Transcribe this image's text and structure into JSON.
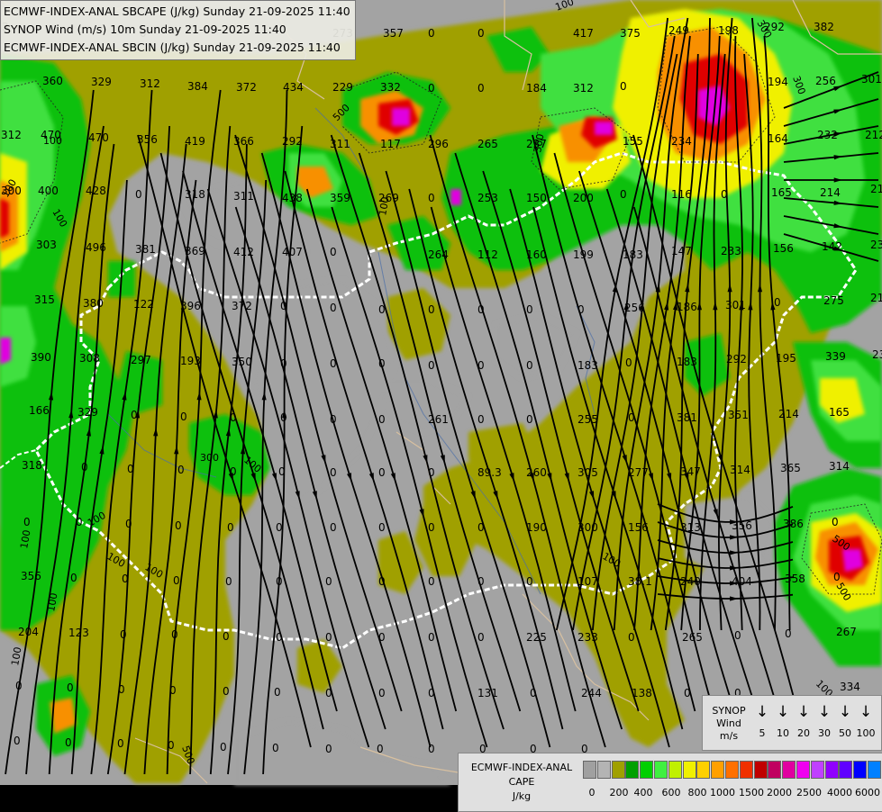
{
  "titles": {
    "line1": "ECMWF-INDEX-ANAL SBCAPE (J/kg) Sunday 21-09-2025 11:40",
    "line2": "SYNOP Wind (m/s) 10m Sunday 21-09-2025 11:40",
    "line3": "ECMWF-INDEX-ANAL SBCIN (J/kg) Sunday 21-09-2025 11:40"
  },
  "colors": {
    "background": "#a3a3a3",
    "olive": "#a0a000",
    "green": "#10c010",
    "lightgreen": "#40e040",
    "yellow": "#f0f000",
    "orange": "#f89000",
    "red": "#e00000",
    "magenta": "#e000e0",
    "border": "#ffffff",
    "coast": "#d8c0a0",
    "wind": "#000000",
    "values": "#000000"
  },
  "synop_legend": {
    "title_lines": [
      "SYNOP",
      "Wind",
      "m/s"
    ],
    "icon": "wind-barb-icon",
    "speeds": [
      "5",
      "10",
      "20",
      "30",
      "50",
      "100"
    ]
  },
  "cape_legend": {
    "title_lines": [
      "ECMWF-INDEX-ANAL",
      "CAPE",
      "J/kg"
    ],
    "colors": [
      "#a0a0a0",
      "#b4b4b4",
      "#a0a000",
      "#00a000",
      "#00d000",
      "#40f040",
      "#c0f000",
      "#f0f000",
      "#ffd000",
      "#ffa000",
      "#ff7000",
      "#f03000",
      "#c00000",
      "#c00060",
      "#e000a0",
      "#f000f0",
      "#c040ff",
      "#9000ff",
      "#6000ff",
      "#0000ff",
      "#0080ff",
      "#00d0ff",
      "#80ffff",
      "#ffffff"
    ],
    "tick_labels": [
      "0",
      "200",
      "400",
      "600",
      "800",
      "1000",
      "1500",
      "2000",
      "2500",
      "4000",
      "6000"
    ]
  },
  "cin_values": [
    {
      "text": "3"
    },
    {
      "text": "0"
    },
    {
      "text": "273"
    },
    {
      "text": "357"
    },
    {
      "text": "0"
    },
    {
      "text": "0"
    },
    {
      "text": "417"
    },
    {
      "text": "375"
    },
    {
      "text": "249"
    },
    {
      "text": "198"
    },
    {
      "text": "292"
    },
    {
      "text": "382"
    },
    {
      "text": "360"
    },
    {
      "text": "329"
    },
    {
      "text": "312"
    },
    {
      "text": "384"
    },
    {
      "text": "372"
    },
    {
      "text": "434"
    },
    {
      "text": "229"
    },
    {
      "text": "332"
    },
    {
      "text": "0"
    },
    {
      "text": "0"
    },
    {
      "text": "184"
    },
    {
      "text": "312"
    },
    {
      "text": "0"
    },
    {
      "text": "194"
    },
    {
      "text": "256"
    },
    {
      "text": "301"
    },
    {
      "text": "312"
    },
    {
      "text": "470"
    },
    {
      "text": "470"
    },
    {
      "text": "356"
    },
    {
      "text": "419"
    },
    {
      "text": "366"
    },
    {
      "text": "292"
    },
    {
      "text": "311"
    },
    {
      "text": "117"
    },
    {
      "text": "296"
    },
    {
      "text": "265"
    },
    {
      "text": "237"
    },
    {
      "text": "155"
    },
    {
      "text": "234"
    },
    {
      "text": "164"
    },
    {
      "text": "232"
    },
    {
      "text": "212"
    },
    {
      "text": "300"
    },
    {
      "text": "400"
    },
    {
      "text": "428"
    },
    {
      "text": "0"
    },
    {
      "text": "318"
    },
    {
      "text": "311"
    },
    {
      "text": "438"
    },
    {
      "text": "359"
    },
    {
      "text": "269"
    },
    {
      "text": "0"
    },
    {
      "text": "253"
    },
    {
      "text": "150"
    },
    {
      "text": "200"
    },
    {
      "text": "0"
    },
    {
      "text": "116"
    },
    {
      "text": "0"
    },
    {
      "text": "165"
    },
    {
      "text": "214"
    },
    {
      "text": "216"
    },
    {
      "text": "303"
    },
    {
      "text": "496"
    },
    {
      "text": "381"
    },
    {
      "text": "369"
    },
    {
      "text": "412"
    },
    {
      "text": "407"
    },
    {
      "text": "0"
    },
    {
      "text": "264"
    },
    {
      "text": "112"
    },
    {
      "text": "160"
    },
    {
      "text": "199"
    },
    {
      "text": "183"
    },
    {
      "text": "147"
    },
    {
      "text": "233"
    },
    {
      "text": "156"
    },
    {
      "text": "142"
    },
    {
      "text": "237"
    },
    {
      "text": "315"
    },
    {
      "text": "380"
    },
    {
      "text": "122"
    },
    {
      "text": "396"
    },
    {
      "text": "372"
    },
    {
      "text": "0"
    },
    {
      "text": "0"
    },
    {
      "text": "0"
    },
    {
      "text": "0"
    },
    {
      "text": "0"
    },
    {
      "text": "0"
    },
    {
      "text": "0"
    },
    {
      "text": "256"
    },
    {
      "text": "186"
    },
    {
      "text": "301"
    },
    {
      "text": "0"
    },
    {
      "text": "275"
    },
    {
      "text": "215"
    },
    {
      "text": "390"
    },
    {
      "text": "308"
    },
    {
      "text": "297"
    },
    {
      "text": "193"
    },
    {
      "text": "350"
    },
    {
      "text": "0"
    },
    {
      "text": "0"
    },
    {
      "text": "0"
    },
    {
      "text": "0"
    },
    {
      "text": "0"
    },
    {
      "text": "0"
    },
    {
      "text": "183"
    },
    {
      "text": "0"
    },
    {
      "text": "183"
    },
    {
      "text": "292"
    },
    {
      "text": "195"
    },
    {
      "text": "339"
    },
    {
      "text": "232"
    },
    {
      "text": "166"
    },
    {
      "text": "329"
    },
    {
      "text": "0"
    },
    {
      "text": "0"
    },
    {
      "text": "0"
    },
    {
      "text": "0"
    },
    {
      "text": "0"
    },
    {
      "text": "0"
    },
    {
      "text": "261"
    },
    {
      "text": "0"
    },
    {
      "text": "0"
    },
    {
      "text": "255"
    },
    {
      "text": "0"
    },
    {
      "text": "381"
    },
    {
      "text": "351"
    },
    {
      "text": "214"
    },
    {
      "text": "165"
    },
    {
      "text": "318"
    },
    {
      "text": "0"
    },
    {
      "text": "0"
    },
    {
      "text": "0"
    },
    {
      "text": "0"
    },
    {
      "text": "0"
    },
    {
      "text": "0"
    },
    {
      "text": "0"
    },
    {
      "text": "0"
    },
    {
      "text": "89.3"
    },
    {
      "text": "260"
    },
    {
      "text": "305"
    },
    {
      "text": "277"
    },
    {
      "text": "347"
    },
    {
      "text": "314"
    },
    {
      "text": "365"
    },
    {
      "text": "314"
    },
    {
      "text": "0"
    },
    {
      "text": "0"
    },
    {
      "text": "0"
    },
    {
      "text": "0"
    },
    {
      "text": "0"
    },
    {
      "text": "0"
    },
    {
      "text": "0"
    },
    {
      "text": "0"
    },
    {
      "text": "0"
    },
    {
      "text": "0"
    },
    {
      "text": "190"
    },
    {
      "text": "300"
    },
    {
      "text": "156"
    },
    {
      "text": "313"
    },
    {
      "text": "356"
    },
    {
      "text": "386"
    },
    {
      "text": "0"
    },
    {
      "text": "356"
    },
    {
      "text": "0"
    },
    {
      "text": "0"
    },
    {
      "text": "0"
    },
    {
      "text": "0"
    },
    {
      "text": "0"
    },
    {
      "text": "0"
    },
    {
      "text": "0"
    },
    {
      "text": "0"
    },
    {
      "text": "0"
    },
    {
      "text": "0"
    },
    {
      "text": "107"
    },
    {
      "text": "38.1"
    },
    {
      "text": "240"
    },
    {
      "text": "404"
    },
    {
      "text": "358"
    },
    {
      "text": "0"
    },
    {
      "text": "204"
    },
    {
      "text": "123"
    },
    {
      "text": "0"
    },
    {
      "text": "0"
    },
    {
      "text": "0"
    },
    {
      "text": "0"
    },
    {
      "text": "0"
    },
    {
      "text": "0"
    },
    {
      "text": "0"
    },
    {
      "text": "0"
    },
    {
      "text": "225"
    },
    {
      "text": "233"
    },
    {
      "text": "0"
    },
    {
      "text": "265"
    },
    {
      "text": "0"
    },
    {
      "text": "0"
    },
    {
      "text": "267"
    },
    {
      "text": "0"
    },
    {
      "text": "0"
    },
    {
      "text": "0"
    },
    {
      "text": "0"
    },
    {
      "text": "0"
    },
    {
      "text": "0"
    },
    {
      "text": "0"
    },
    {
      "text": "0"
    },
    {
      "text": "0"
    },
    {
      "text": "131"
    },
    {
      "text": "0"
    },
    {
      "text": "244"
    },
    {
      "text": "138"
    },
    {
      "text": "0"
    },
    {
      "text": "0"
    },
    {
      "text": "334"
    },
    {
      "text": "0"
    },
    {
      "text": "0"
    },
    {
      "text": "0"
    },
    {
      "text": "0"
    },
    {
      "text": "0"
    },
    {
      "text": "0"
    },
    {
      "text": "0"
    },
    {
      "text": "0"
    },
    {
      "text": "0"
    },
    {
      "text": "0"
    },
    {
      "text": "0"
    },
    {
      "text": "0"
    }
  ],
  "contour_labels": [
    {
      "text": "100"
    },
    {
      "text": "100"
    },
    {
      "text": "100"
    },
    {
      "text": "100"
    },
    {
      "text": "100"
    },
    {
      "text": "100"
    },
    {
      "text": "100"
    },
    {
      "text": "100"
    },
    {
      "text": "100"
    },
    {
      "text": "300"
    },
    {
      "text": "300"
    },
    {
      "text": "300"
    },
    {
      "text": "500"
    },
    {
      "text": "500"
    },
    {
      "text": "500"
    },
    {
      "text": "100"
    },
    {
      "text": "100"
    },
    {
      "text": "100"
    },
    {
      "text": "100"
    },
    {
      "text": "100"
    },
    {
      "text": "100"
    },
    {
      "text": "100"
    },
    {
      "text": "500"
    },
    {
      "text": "300"
    }
  ]
}
